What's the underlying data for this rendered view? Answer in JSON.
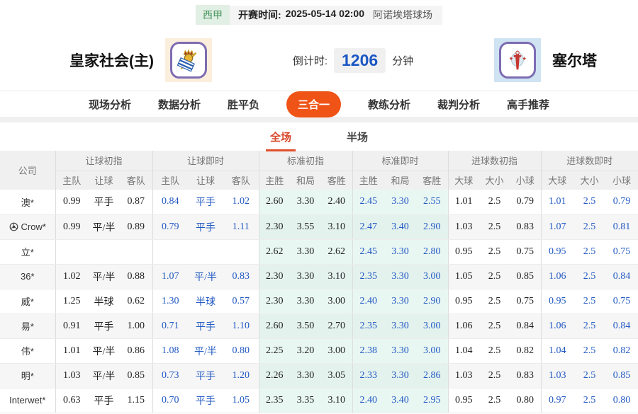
{
  "match_header": {
    "league": "西甲",
    "kickoff_label": "开赛时间:",
    "kickoff_time": "2025-05-14 02:00",
    "venue": "阿诺埃塔球场",
    "home_team": "皇家社会(主)",
    "away_team": "塞尔塔",
    "countdown_label": "倒计时:",
    "countdown_value": "1206",
    "countdown_unit": "分钟"
  },
  "nav": {
    "items": [
      {
        "label": "现场分析",
        "active": false
      },
      {
        "label": "数据分析",
        "active": false
      },
      {
        "label": "胜平负",
        "active": false
      },
      {
        "label": "三合一",
        "active": true
      },
      {
        "label": "教练分析",
        "active": false
      },
      {
        "label": "裁判分析",
        "active": false
      },
      {
        "label": "高手推荐",
        "active": false
      }
    ]
  },
  "subtabs": {
    "items": [
      {
        "label": "全场",
        "active": true
      },
      {
        "label": "半场",
        "active": false
      }
    ]
  },
  "table": {
    "company_header": "公司",
    "groups": [
      {
        "label": "让球初指",
        "cols": [
          "主队",
          "让球",
          "客队"
        ],
        "live": false,
        "highlight": false
      },
      {
        "label": "让球即时",
        "cols": [
          "主队",
          "让球",
          "客队"
        ],
        "live": true,
        "highlight": false
      },
      {
        "label": "标准初指",
        "cols": [
          "主胜",
          "和局",
          "客胜"
        ],
        "live": false,
        "highlight": true
      },
      {
        "label": "标准即时",
        "cols": [
          "主胜",
          "和局",
          "客胜"
        ],
        "live": true,
        "highlight": true
      },
      {
        "label": "进球数初指",
        "cols": [
          "大球",
          "大小",
          "小球"
        ],
        "live": false,
        "highlight": false
      },
      {
        "label": "进球数即时",
        "cols": [
          "大球",
          "大小",
          "小球"
        ],
        "live": true,
        "highlight": false
      }
    ],
    "rows": [
      {
        "company": "澳*",
        "has_icon": false,
        "values": [
          [
            "0.99",
            "平手",
            "0.87"
          ],
          [
            "0.84",
            "平手",
            "1.02"
          ],
          [
            "2.60",
            "3.30",
            "2.40"
          ],
          [
            "2.45",
            "3.30",
            "2.55"
          ],
          [
            "1.01",
            "2.5",
            "0.79"
          ],
          [
            "1.01",
            "2.5",
            "0.79"
          ]
        ]
      },
      {
        "company": "Crow*",
        "has_icon": true,
        "values": [
          [
            "0.99",
            "平/半",
            "0.89"
          ],
          [
            "0.79",
            "平手",
            "1.11"
          ],
          [
            "2.30",
            "3.55",
            "3.10"
          ],
          [
            "2.47",
            "3.40",
            "2.90"
          ],
          [
            "1.03",
            "2.5",
            "0.83"
          ],
          [
            "1.07",
            "2.5",
            "0.81"
          ]
        ]
      },
      {
        "company": "立*",
        "has_icon": false,
        "values": [
          [
            "",
            "",
            ""
          ],
          [
            "",
            "",
            ""
          ],
          [
            "2.62",
            "3.30",
            "2.62"
          ],
          [
            "2.45",
            "3.30",
            "2.80"
          ],
          [
            "0.95",
            "2.5",
            "0.75"
          ],
          [
            "0.95",
            "2.5",
            "0.75"
          ]
        ]
      },
      {
        "company": "36*",
        "has_icon": false,
        "values": [
          [
            "1.02",
            "平/半",
            "0.88"
          ],
          [
            "1.07",
            "平/半",
            "0.83"
          ],
          [
            "2.30",
            "3.30",
            "3.10"
          ],
          [
            "2.35",
            "3.30",
            "3.00"
          ],
          [
            "1.05",
            "2.5",
            "0.85"
          ],
          [
            "1.06",
            "2.5",
            "0.84"
          ]
        ]
      },
      {
        "company": "威*",
        "has_icon": false,
        "values": [
          [
            "1.25",
            "半球",
            "0.62"
          ],
          [
            "1.30",
            "半球",
            "0.57"
          ],
          [
            "2.30",
            "3.30",
            "3.00"
          ],
          [
            "2.40",
            "3.30",
            "2.90"
          ],
          [
            "0.95",
            "2.5",
            "0.75"
          ],
          [
            "0.95",
            "2.5",
            "0.75"
          ]
        ]
      },
      {
        "company": "易*",
        "has_icon": false,
        "values": [
          [
            "0.91",
            "平手",
            "1.00"
          ],
          [
            "0.71",
            "平手",
            "1.10"
          ],
          [
            "2.60",
            "3.50",
            "2.70"
          ],
          [
            "2.35",
            "3.30",
            "3.00"
          ],
          [
            "1.06",
            "2.5",
            "0.84"
          ],
          [
            "1.06",
            "2.5",
            "0.84"
          ]
        ]
      },
      {
        "company": "伟*",
        "has_icon": false,
        "values": [
          [
            "1.01",
            "平/半",
            "0.86"
          ],
          [
            "1.08",
            "平/半",
            "0.80"
          ],
          [
            "2.25",
            "3.20",
            "3.00"
          ],
          [
            "2.38",
            "3.30",
            "3.00"
          ],
          [
            "1.04",
            "2.5",
            "0.82"
          ],
          [
            "1.04",
            "2.5",
            "0.82"
          ]
        ]
      },
      {
        "company": "明*",
        "has_icon": false,
        "values": [
          [
            "1.03",
            "平/半",
            "0.85"
          ],
          [
            "0.73",
            "平手",
            "1.20"
          ],
          [
            "2.26",
            "3.30",
            "3.05"
          ],
          [
            "2.33",
            "3.30",
            "2.86"
          ],
          [
            "1.03",
            "2.5",
            "0.83"
          ],
          [
            "1.03",
            "2.5",
            "0.85"
          ]
        ]
      },
      {
        "company": "Interwet*",
        "has_icon": false,
        "values": [
          [
            "0.63",
            "平手",
            "1.15"
          ],
          [
            "0.70",
            "平手",
            "1.05"
          ],
          [
            "2.35",
            "3.35",
            "3.10"
          ],
          [
            "2.40",
            "3.40",
            "2.95"
          ],
          [
            "0.95",
            "2.5",
            "0.80"
          ],
          [
            "0.97",
            "2.5",
            "0.80"
          ]
        ]
      }
    ]
  },
  "colors": {
    "accent_orange": "#f05316",
    "subtab_orange": "#d8472a",
    "live_blue": "#2159c3",
    "countdown_blue": "#1a56c4",
    "league_green": "#3f9159",
    "highlight_cyan": "#e9f7f3",
    "header_gray": "#f0f0f0"
  }
}
